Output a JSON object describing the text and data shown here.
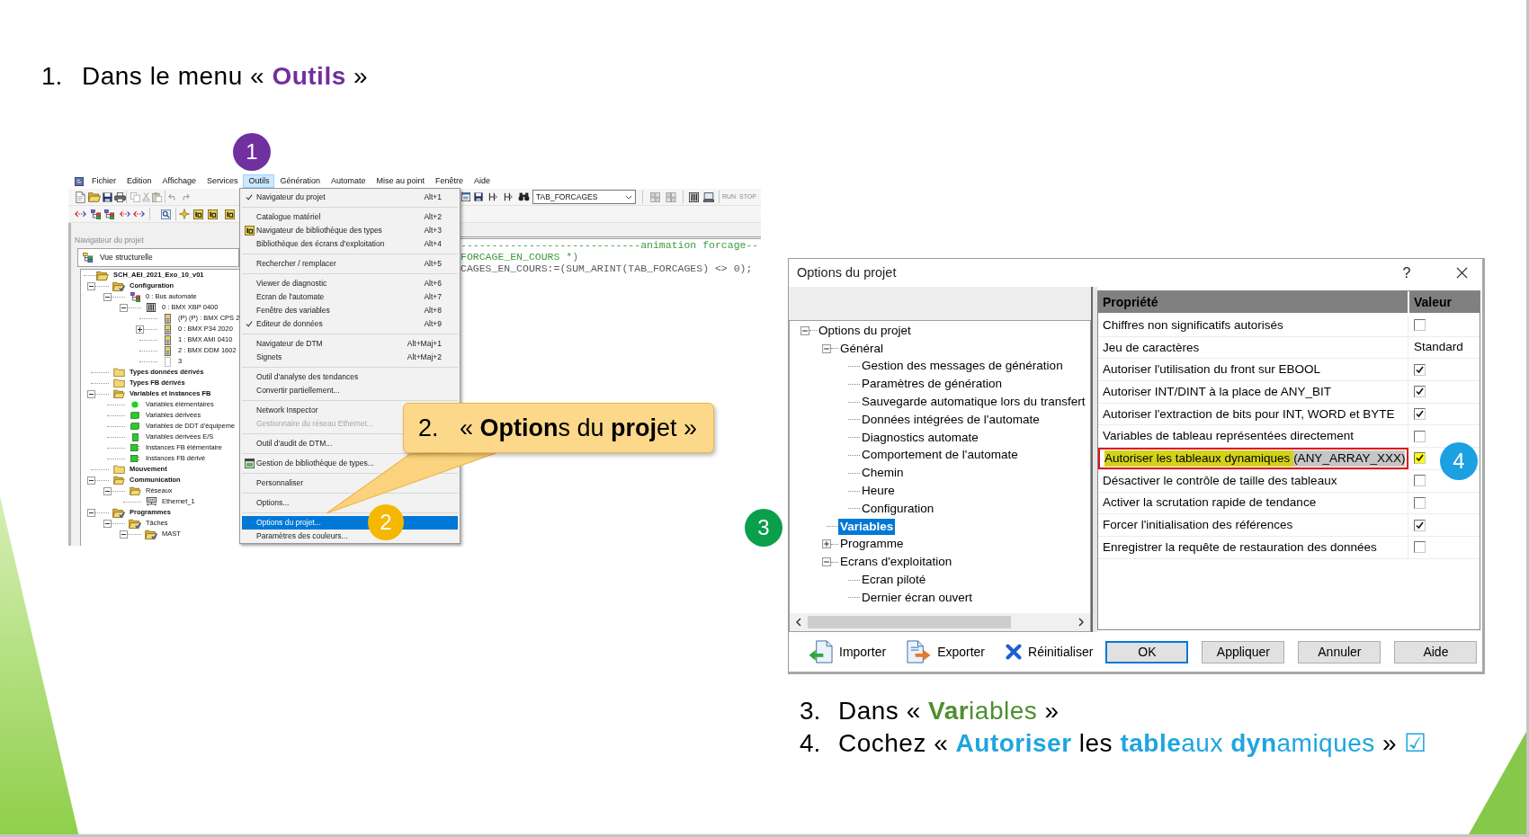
{
  "slide_heading": {
    "number": "1.",
    "color": "#7030a0",
    "parts": [
      {
        "text": "Dans le menu « ",
        "emphasis": false
      },
      {
        "text": "**Outils**",
        "emphasis": true
      },
      {
        "text": " »",
        "emphasis": false
      }
    ]
  },
  "app_window": {
    "menu_bar": [
      {
        "label": "Fichier",
        "selected": false
      },
      {
        "label": "Edition",
        "selected": false
      },
      {
        "label": "Affichage",
        "selected": false
      },
      {
        "label": "Services",
        "selected": false
      },
      {
        "label": "Outils",
        "selected": true
      },
      {
        "label": "Génération",
        "selected": false
      },
      {
        "label": "Automate",
        "selected": false
      },
      {
        "label": "Mise au point",
        "selected": false
      },
      {
        "label": "Fenêtre",
        "selected": false
      },
      {
        "label": "Aide",
        "selected": false
      }
    ],
    "toolbar": {
      "dropdown": "TAB_FORCAGES",
      "buttons": [
        "RUN",
        "STOP"
      ]
    },
    "navigator": {
      "title": "Navigateur du projet",
      "view": "Vue structurelle",
      "tree": [
        {
          "label": "SCH_AEI_2021_Exo_10_v01",
          "kind": "project",
          "children": [
            {
              "label": "Configuration",
              "kind": "marked-folder",
              "expanded": true,
              "children": [
                {
                  "label": "0 : Bus automate",
                  "kind": "bus",
                  "expanded": true,
                  "children": [
                    {
                      "label": "0 : BMX XBP 0400",
                      "kind": "rack",
                      "expanded": true,
                      "children": [
                        {
                          "label": "(P) (P) : BMX CPS 2",
                          "kind": "module"
                        },
                        {
                          "label": "0 : BMX P34 2020",
                          "kind": "module",
                          "expanded": false
                        },
                        {
                          "label": "1 : BMX AMI 0410",
                          "kind": "module"
                        },
                        {
                          "label": "2 : BMX DDM 1602",
                          "kind": "module"
                        },
                        {
                          "label": "3",
                          "kind": "slot"
                        }
                      ]
                    }
                  ]
                }
              ]
            },
            {
              "label": "Types données dérivés",
              "kind": "folder"
            },
            {
              "label": "Types FB dérivés",
              "kind": "folder"
            },
            {
              "label": "Variables et instances FB",
              "kind": "open-folder",
              "expanded": true,
              "children": [
                {
                  "label": "Variables élémentaires",
                  "kind": "variable-dot"
                },
                {
                  "label": "Variables dérivées",
                  "kind": "variable-block"
                },
                {
                  "label": "Variables de DDT d'équipeme",
                  "kind": "variable-block"
                },
                {
                  "label": "Variables dérivées E/S",
                  "kind": "variable-square"
                },
                {
                  "label": "Instances FB élémentaire",
                  "kind": "instance"
                },
                {
                  "label": "Instances FB dérivé",
                  "kind": "instance"
                }
              ]
            },
            {
              "label": "Mouvement",
              "kind": "folder"
            },
            {
              "label": "Communication",
              "kind": "open-folder",
              "expanded": true,
              "children": [
                {
                  "label": "Réseaux",
                  "kind": "open-folder",
                  "expanded": true,
                  "children": [
                    {
                      "label": "Ethernet_1",
                      "kind": "network"
                    }
                  ]
                }
              ]
            },
            {
              "label": "Programmes",
              "kind": "marked-folder",
              "expanded": true,
              "children": [
                {
                  "label": "Tâches",
                  "kind": "marked-folder",
                  "expanded": true,
                  "children": [
                    {
                      "label": "MAST",
                      "kind": "marked-folder",
                      "expanded": true
                    }
                  ]
                }
              ]
            }
          ]
        }
      ]
    },
    "code_lines": [
      {
        "kind": "comment",
        "text": "-----------------------------animation forcage--"
      },
      {
        "kind": "comment",
        "text": "FORCAGE_EN_COURS *)"
      },
      {
        "kind": "statement",
        "text": "CAGES_EN_COURS:=(SUM_ARINT(TAB_FORCAGES) <> 0);"
      }
    ],
    "tools_menu": [
      {
        "kind": "item",
        "label": "Navigateur du projet",
        "shortcut": "Alt+1",
        "checked": true,
        "disabled": false,
        "selected": false,
        "icon": false
      },
      {
        "kind": "separator"
      },
      {
        "kind": "item",
        "label": "Catalogue matériel",
        "shortcut": "Alt+2",
        "checked": false,
        "disabled": false,
        "selected": false,
        "icon": false
      },
      {
        "kind": "item",
        "label": "Navigateur de bibliothèque des types",
        "shortcut": "Alt+3",
        "checked": false,
        "disabled": false,
        "selected": false,
        "icon": true
      },
      {
        "kind": "item",
        "label": "Bibliothèque des écrans d'exploitation",
        "shortcut": "Alt+4",
        "checked": false,
        "disabled": false,
        "selected": false,
        "icon": false
      },
      {
        "kind": "separator"
      },
      {
        "kind": "item",
        "label": "Rechercher / remplacer",
        "shortcut": "Alt+5",
        "checked": false,
        "disabled": false,
        "selected": false,
        "icon": false
      },
      {
        "kind": "separator"
      },
      {
        "kind": "item",
        "label": "Viewer de diagnostic",
        "shortcut": "Alt+6",
        "checked": false,
        "disabled": false,
        "selected": false,
        "icon": false
      },
      {
        "kind": "item",
        "label": "Ecran de l'automate",
        "shortcut": "Alt+7",
        "checked": false,
        "disabled": false,
        "selected": false,
        "icon": false
      },
      {
        "kind": "item",
        "label": "Fenêtre des variables",
        "shortcut": "Alt+8",
        "checked": false,
        "disabled": false,
        "selected": false,
        "icon": false
      },
      {
        "kind": "item",
        "label": "Editeur de données",
        "shortcut": "Alt+9",
        "checked": true,
        "disabled": false,
        "selected": false,
        "icon": false
      },
      {
        "kind": "separator"
      },
      {
        "kind": "item",
        "label": "Navigateur de DTM",
        "shortcut": "Alt+Maj+1",
        "checked": false,
        "disabled": false,
        "selected": false,
        "icon": false
      },
      {
        "kind": "item",
        "label": "Signets",
        "shortcut": "Alt+Maj+2",
        "checked": false,
        "disabled": false,
        "selected": false,
        "icon": false
      },
      {
        "kind": "separator"
      },
      {
        "kind": "item",
        "label": "Outil d'analyse des tendances",
        "checked": false,
        "disabled": false,
        "selected": false,
        "icon": false
      },
      {
        "kind": "item",
        "label": "Convertir partiellement...",
        "checked": false,
        "disabled": false,
        "selected": false,
        "icon": false
      },
      {
        "kind": "separator"
      },
      {
        "kind": "item",
        "label": "Network Inspector",
        "checked": false,
        "disabled": false,
        "selected": false,
        "icon": false
      },
      {
        "kind": "item",
        "label": "Gestionnaire du réseau Ethernet...",
        "checked": false,
        "disabled": true,
        "selected": false,
        "icon": false
      },
      {
        "kind": "separator"
      },
      {
        "kind": "item",
        "label": "Outil d'audit de DTM...",
        "checked": false,
        "disabled": false,
        "selected": false,
        "icon": false
      },
      {
        "kind": "separator"
      },
      {
        "kind": "item",
        "label": "Gestion de bibliothèque de types...",
        "checked": false,
        "disabled": false,
        "selected": false,
        "icon": true
      },
      {
        "kind": "separator"
      },
      {
        "kind": "item",
        "label": "Personnaliser",
        "checked": false,
        "disabled": false,
        "selected": false,
        "icon": false
      },
      {
        "kind": "separator"
      },
      {
        "kind": "item",
        "label": "Options...",
        "checked": false,
        "disabled": false,
        "selected": false,
        "icon": false
      },
      {
        "kind": "separator"
      },
      {
        "kind": "item",
        "label": "Options du projet...",
        "checked": false,
        "disabled": false,
        "selected": true,
        "icon": false
      },
      {
        "kind": "item",
        "label": "Paramètres des couleurs...",
        "checked": false,
        "disabled": false,
        "selected": false,
        "icon": false
      }
    ]
  },
  "callout": {
    "number": "2.",
    "text": "« **Option**s du **proj**et »"
  },
  "options_dialog": {
    "title": "Options du projet",
    "help": "?",
    "tree": [
      {
        "label": "Options du projet",
        "expanded": true,
        "selected": false,
        "children": [
          {
            "label": "Général",
            "expanded": true,
            "selected": false,
            "children": [
              {
                "label": "Gestion des messages de génération",
                "selected": false
              },
              {
                "label": "Paramètres de génération",
                "selected": false
              },
              {
                "label": "Sauvegarde automatique lors du transfert",
                "selected": false
              },
              {
                "label": "Données intégrées de l'automate",
                "selected": false
              },
              {
                "label": "Diagnostics automate",
                "selected": false
              },
              {
                "label": "Comportement de l'automate",
                "selected": false
              },
              {
                "label": "Chemin",
                "selected": false
              },
              {
                "label": "Heure",
                "selected": false
              },
              {
                "label": "Configuration",
                "selected": false
              }
            ]
          },
          {
            "label": "Variables",
            "selected": true
          },
          {
            "label": "Programme",
            "expanded": false,
            "selected": false
          },
          {
            "label": "Ecrans d'exploitation",
            "expanded": true,
            "selected": false,
            "children": [
              {
                "label": "Ecran piloté",
                "selected": false
              },
              {
                "label": "Dernier écran ouvert",
                "selected": false
              }
            ]
          }
        ]
      }
    ],
    "table": {
      "columns": [
        "Propriété",
        "Valeur"
      ],
      "rows": [
        {
          "segments": [
            {
              "text": "Chiffres non significatifs autorisés",
              "highlighted": false
            }
          ],
          "value": {
            "kind": "checkbox",
            "checked": false,
            "highlighted": false
          },
          "selected": false,
          "outlined": false
        },
        {
          "segments": [
            {
              "text": "Jeu de caractères",
              "highlighted": false
            }
          ],
          "value": {
            "kind": "text",
            "text": "Standard"
          },
          "selected": false,
          "outlined": false
        },
        {
          "segments": [
            {
              "text": "Autoriser l'utilisation du front sur EBOOL",
              "highlighted": false
            }
          ],
          "value": {
            "kind": "checkbox",
            "checked": true,
            "highlighted": false
          },
          "selected": false,
          "outlined": false
        },
        {
          "segments": [
            {
              "text": "Autoriser INT/DINT à la place de ANY_BIT",
              "highlighted": false
            }
          ],
          "value": {
            "kind": "checkbox",
            "checked": true,
            "highlighted": false
          },
          "selected": false,
          "outlined": false
        },
        {
          "segments": [
            {
              "text": "Autoriser l'extraction de bits pour INT, WORD et BYTE",
              "highlighted": false
            }
          ],
          "value": {
            "kind": "checkbox",
            "checked": true,
            "highlighted": false
          },
          "selected": false,
          "outlined": false
        },
        {
          "segments": [
            {
              "text": "Variables de tableau représentées directement",
              "highlighted": false
            }
          ],
          "value": {
            "kind": "checkbox",
            "checked": false,
            "highlighted": false
          },
          "selected": false,
          "outlined": false
        },
        {
          "segments": [
            {
              "text": "Autoriser les tableaux dynamiques ",
              "highlighted": true
            },
            {
              "text": "(ANY_ARRAY_XXX)",
              "highlighted": false
            }
          ],
          "value": {
            "kind": "checkbox",
            "checked": true,
            "highlighted": true
          },
          "selected": true,
          "outlined": true
        },
        {
          "segments": [
            {
              "text": "Désactiver le contrôle de taille des tableaux",
              "highlighted": false
            }
          ],
          "value": {
            "kind": "checkbox",
            "checked": false,
            "highlighted": false
          },
          "selected": false,
          "outlined": false
        },
        {
          "segments": [
            {
              "text": "Activer la scrutation rapide de tendance",
              "highlighted": false
            }
          ],
          "value": {
            "kind": "checkbox",
            "checked": false,
            "highlighted": false
          },
          "selected": false,
          "outlined": false
        },
        {
          "segments": [
            {
              "text": "Forcer l'initialisation des références",
              "highlighted": false
            }
          ],
          "value": {
            "kind": "checkbox",
            "checked": true,
            "highlighted": false
          },
          "selected": false,
          "outlined": false
        },
        {
          "segments": [
            {
              "text": "Enregistrer la requête de restauration des données",
              "highlighted": false
            }
          ],
          "value": {
            "kind": "checkbox",
            "checked": false,
            "highlighted": false
          },
          "selected": false,
          "outlined": false
        }
      ]
    },
    "buttons": [
      {
        "label": "Importer",
        "kind": "icon",
        "default": false
      },
      {
        "label": "Exporter",
        "kind": "icon",
        "default": false
      },
      {
        "label": "Réinitialiser",
        "kind": "icon",
        "default": false
      },
      {
        "label": "OK",
        "kind": "push",
        "default": true
      },
      {
        "label": "Appliquer",
        "kind": "push",
        "default": false
      },
      {
        "label": "Annuler",
        "kind": "push",
        "default": false
      },
      {
        "label": "Aide",
        "kind": "push",
        "default": false
      }
    ]
  },
  "slide_steps": [
    {
      "number": "3.",
      "color": "#4e8f2f",
      "parts": [
        {
          "text": "Dans « ",
          "emphasis": false
        },
        {
          "text": "**Var**iables",
          "emphasis": true
        },
        {
          "text": " »",
          "emphasis": false
        }
      ]
    },
    {
      "number": "4.",
      "color": "#1ea5e0",
      "parts": [
        {
          "text": "Cochez « ",
          "emphasis": false
        },
        {
          "text": "**Autoriser**",
          "emphasis": true
        },
        {
          "text": " les ",
          "emphasis": false
        },
        {
          "text": "**table**aux ",
          "emphasis": true
        },
        {
          "text": "**dyn**amiques",
          "emphasis": true
        },
        {
          "text": " » ",
          "emphasis": false
        },
        {
          "text": "☑",
          "emphasis": true
        }
      ]
    }
  ],
  "step_badges": [
    {
      "label": "1",
      "color": "#7030a0"
    },
    {
      "label": "2",
      "color": "#f5b700"
    },
    {
      "label": "3",
      "color": "#0a9f4b"
    },
    {
      "label": "4",
      "color": "#1ba1e2"
    }
  ]
}
